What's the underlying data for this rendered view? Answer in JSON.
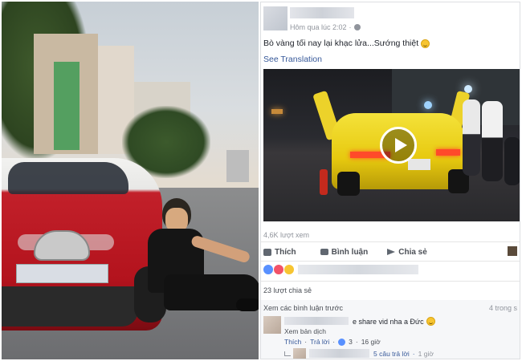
{
  "post": {
    "timestamp": "Hôm qua lúc 2:02",
    "caption": "Bò vàng tối nay lại khạc lửa...Sướng thiệt",
    "see_translation": "See Translation",
    "views": "4,6K lượt xem",
    "actions": {
      "like": "Thích",
      "comment": "Bình luận",
      "share": "Chia sẻ"
    },
    "shares": "23 lượt chia sẻ",
    "icons": {
      "privacy": "globe-icon",
      "emoji": "smile-icon",
      "play": "play-icon",
      "like": "like-icon",
      "comment": "comment-icon",
      "share": "share-icon"
    }
  },
  "comments": {
    "view_previous": "Xem các bình luận trước",
    "count": "4 trong s",
    "first": {
      "text": "e share vid nha a Đức",
      "translate": "Xem bản dịch",
      "like": "Thích",
      "reply": "Trả lời",
      "reactions": "3",
      "time": "16 giờ"
    },
    "reply_preview": {
      "text": "5 câu trả lời",
      "time": "1 giờ"
    }
  },
  "colors": {
    "link": "#365899",
    "muted": "#90949c",
    "text": "#1d2129",
    "like_blue": "#5890ff",
    "love_red": "#f25268",
    "wow_yellow": "#f7c531"
  }
}
